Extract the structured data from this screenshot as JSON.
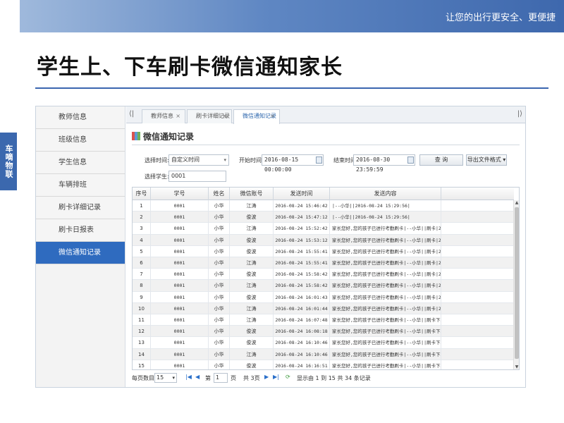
{
  "banner": {
    "tagline": "让您的出行更安全、更便捷"
  },
  "slide": {
    "title": "学生上、下车刷卡微信通知家长"
  },
  "side_tab": {
    "label": "车嘀物联"
  },
  "sidebar": {
    "items": [
      {
        "label": "教师信息",
        "active": false
      },
      {
        "label": "班级信息",
        "active": false
      },
      {
        "label": "学生信息",
        "active": false
      },
      {
        "label": "车辆排班",
        "active": false
      },
      {
        "label": "刷卡详细记录",
        "active": false
      },
      {
        "label": "刷卡日报表",
        "active": false
      },
      {
        "label": "微信通知记录",
        "active": true
      }
    ]
  },
  "tabs": {
    "left_arrow": "⟨|",
    "right_arrow": "|⟩",
    "items": [
      {
        "label": "教师信息",
        "close": "×"
      },
      {
        "label": "刷卡详细记录",
        "close": "×"
      },
      {
        "label": "微信通知记录",
        "close": "×"
      }
    ]
  },
  "panel": {
    "title": "微信通知记录"
  },
  "filters": {
    "time_label": "选择时间:",
    "time_value": "自定义时间",
    "start_label": "开始时间:",
    "start_value": "2016-08-15 00:00:00",
    "end_label": "结束时间:",
    "end_value": "2016-08-30 23:59:59",
    "search_button": "查 询",
    "export_button": "导出文件格式 ▾",
    "student_label": "选择学生:",
    "student_value": "0001"
  },
  "grid": {
    "columns": [
      "序号",
      "学号",
      "姓名",
      "微信账号",
      "发送时间",
      "发送内容"
    ],
    "rows": [
      [
        "1",
        "0001",
        "小华",
        "江涛",
        "2016-08-24 15:46:42",
        "|--小华||2016-08-24 15:29:56|"
      ],
      [
        "2",
        "0001",
        "小华",
        "俊波",
        "2016-08-24 15:47:12",
        "|--小华||2016-08-24 15:29:56|"
      ],
      [
        "3",
        "0001",
        "小华",
        "江涛",
        "2016-08-24 15:52:42",
        "家长您好,您的孩子已进行考勤刷卡|--小华||刷卡|2016-08"
      ],
      [
        "4",
        "0001",
        "小华",
        "俊波",
        "2016-08-24 15:53:12",
        "家长您好,您的孩子已进行考勤刷卡|--小华||刷卡|2016-08"
      ],
      [
        "5",
        "0001",
        "小华",
        "俊波",
        "2016-08-24 15:55:41",
        "家长您好,您的孩子已进行考勤刷卡|--小华||刷卡|2016-08"
      ],
      [
        "6",
        "0001",
        "小华",
        "江涛",
        "2016-08-24 15:55:41",
        "家长您好,您的孩子已进行考勤刷卡|--小华||刷卡|2016-08"
      ],
      [
        "7",
        "0001",
        "小华",
        "俊波",
        "2016-08-24 15:58:42",
        "家长您好,您的孩子已进行考勤刷卡|--小华||刷卡|2016-08"
      ],
      [
        "8",
        "0001",
        "小华",
        "江涛",
        "2016-08-24 15:58:42",
        "家长您好,您的孩子已进行考勤刷卡|--小华||刷卡|2016-08"
      ],
      [
        "9",
        "0001",
        "小华",
        "俊波",
        "2016-08-24 16:01:43",
        "家长您好,您的孩子已进行考勤刷卡|--小华||刷卡|2016-08"
      ],
      [
        "10",
        "0001",
        "小华",
        "江涛",
        "2016-08-24 16:01:44",
        "家长您好,您的孩子已进行考勤刷卡|--小华||刷卡|2016-08"
      ],
      [
        "11",
        "0001",
        "小华",
        "江涛",
        "2016-08-24 16:07:48",
        "家长您好,您的孩子已进行考勤刷卡|--小华||刷卡下车|201"
      ],
      [
        "12",
        "0001",
        "小华",
        "俊波",
        "2016-08-24 16:08:18",
        "家长您好,您的孩子已进行考勤刷卡|--小华||刷卡下车|201"
      ],
      [
        "13",
        "0001",
        "小华",
        "俊波",
        "2016-08-24 16:10:46",
        "家长您好,您的孩子已进行考勤刷卡|--小华||刷卡下车|201"
      ],
      [
        "14",
        "0001",
        "小华",
        "江涛",
        "2016-08-24 16:10:46",
        "家长您好,您的孩子已进行考勤刷卡|--小华||刷卡下车|201"
      ],
      [
        "15",
        "0001",
        "小华",
        "俊波",
        "2016-08-24 16:16:51",
        "家长您好,您的孩子已进行考勤刷卡|--小华||刷卡下车|201"
      ]
    ]
  },
  "pager": {
    "page_size_label": "每页数目",
    "page_size": "15",
    "page_prefix": "第",
    "page_value": "1",
    "page_suffix": "页",
    "total_pages": "共 3页",
    "summary": "显示由 1 到 15 共 34 条记录"
  }
}
